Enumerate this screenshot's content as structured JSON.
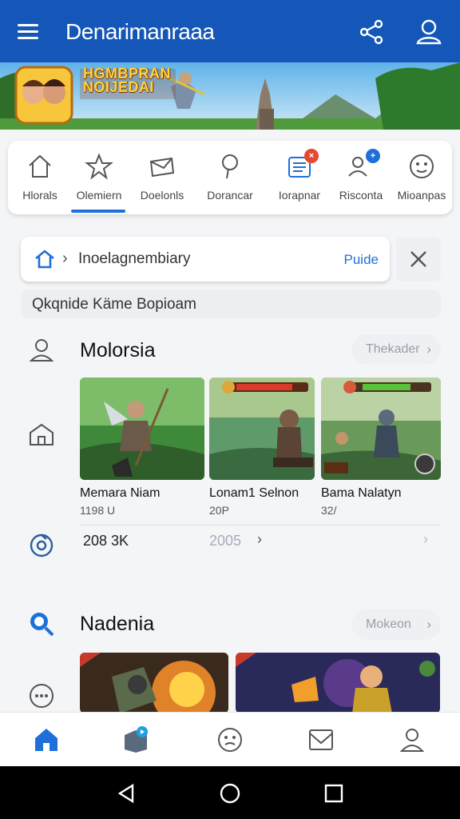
{
  "app_bar": {
    "title": "Denarimanraaa",
    "menu_icon": "menu-icon",
    "share_icon": "share-icon",
    "profile_icon": "person-icon",
    "color": "#1457b8"
  },
  "banner": {
    "text_line1": "HGMBPRAN",
    "text_line2": "NOIJEDAI"
  },
  "categories": [
    {
      "label": "Hlorals",
      "icon": "home-outline-icon"
    },
    {
      "label": "Olemiern",
      "icon": "star-icon",
      "active": true
    },
    {
      "label": "Doelonls",
      "icon": "envelope-icon"
    },
    {
      "label": "Dorancar",
      "icon": "pin-icon"
    },
    {
      "label": "Iorapnar",
      "icon": "list-icon",
      "badge": "×"
    },
    {
      "label": "Risconta",
      "icon": "people-icon",
      "badge": "+"
    },
    {
      "label": "Mioanpas",
      "icon": "face-icon"
    }
  ],
  "breadcrumb": {
    "text": "Inoelagnembiary",
    "action": "Puide"
  },
  "subtitle": "Qkqnide Käme Bopioam",
  "section1": {
    "title": "Molorsia",
    "more": "Thekader",
    "games": [
      {
        "name": "Memara Niam",
        "meta": "1198 U"
      },
      {
        "name": "Lonam1 Selnon",
        "meta": "20P"
      },
      {
        "name": "Bama Nalatyn",
        "meta": "32/"
      }
    ],
    "stat_primary": "208 3K",
    "stat_secondary": "2005"
  },
  "section2": {
    "title": "Nadenia",
    "more": "Mokeon"
  },
  "bottom_nav": [
    "home-icon",
    "box-icon",
    "face-icon",
    "mail-icon",
    "person-icon"
  ],
  "accent": "#1e6fd9"
}
